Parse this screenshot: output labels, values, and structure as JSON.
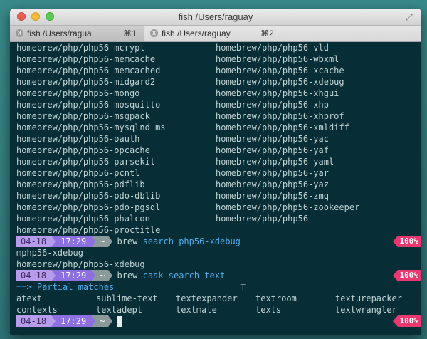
{
  "window": {
    "title": "fish  /Users/raguay",
    "fullscreen_icon": "fullscreen-arrows-icon"
  },
  "tabs": [
    {
      "label": "fish  /Users/ragua",
      "shortcut": "⌘1",
      "close": "x"
    },
    {
      "label": "fish  /Users/raguay",
      "shortcut": "⌘2",
      "close": "x"
    }
  ],
  "listing": {
    "left": [
      "homebrew/php/php56-mcrypt",
      "homebrew/php/php56-memcache",
      "homebrew/php/php56-memcached",
      "homebrew/php/php56-midgard2",
      "homebrew/php/php56-mongo",
      "homebrew/php/php56-mosquitto",
      "homebrew/php/php56-msgpack",
      "homebrew/php/php56-mysqlnd_ms",
      "homebrew/php/php56-oauth",
      "homebrew/php/php56-opcache",
      "homebrew/php/php56-parsekit",
      "homebrew/php/php56-pcntl",
      "homebrew/php/php56-pdflib",
      "homebrew/php/php56-pdo-dblib",
      "homebrew/php/php56-pdo-pgsql",
      "homebrew/php/php56-phalcon",
      "homebrew/php/php56-proctitle"
    ],
    "right": [
      "homebrew/php/php56-vld",
      "homebrew/php/php56-wbxml",
      "homebrew/php/php56-xcache",
      "homebrew/php/php56-xdebug",
      "homebrew/php/php56-xhgui",
      "homebrew/php/php56-xhp",
      "homebrew/php/php56-xhprof",
      "homebrew/php/php56-xmldiff",
      "homebrew/php/php56-yac",
      "homebrew/php/php56-yaf",
      "homebrew/php/php56-yaml",
      "homebrew/php/php56-yar",
      "homebrew/php/php56-yaz",
      "homebrew/php/php56-zmq",
      "homebrew/php/php56-zookeeper",
      "homebrew/php/php56"
    ]
  },
  "prompt": {
    "date": "04-18",
    "time": "17:29",
    "dir": "~",
    "status": "100%"
  },
  "commands": [
    {
      "pre": "brew ",
      "hl1": "search",
      "mid": " ",
      "hl2": "php56-xdebug"
    },
    {
      "pre": "brew ",
      "hl1": "cask",
      "mid": " ",
      "hl2": "search text"
    }
  ],
  "search_results": [
    "mphp56-xdebug",
    "homebrew/php/php56-xdebug"
  ],
  "partial_header": "==> Partial matches",
  "partial_matches": [
    [
      "atext",
      "sublime-text",
      "textexpander",
      "textroom",
      "texturepacker"
    ],
    [
      "contexts",
      "textadept",
      "textmate",
      "texts",
      "textwrangler"
    ]
  ],
  "colors": {
    "terminal_bg": "#072d36",
    "date_segment": "#b79ceb",
    "time_segment": "#8c6fe0",
    "dir_segment": "#8a9a9a",
    "status_badge": "#e8386f",
    "highlight": "#4fb0f0"
  }
}
